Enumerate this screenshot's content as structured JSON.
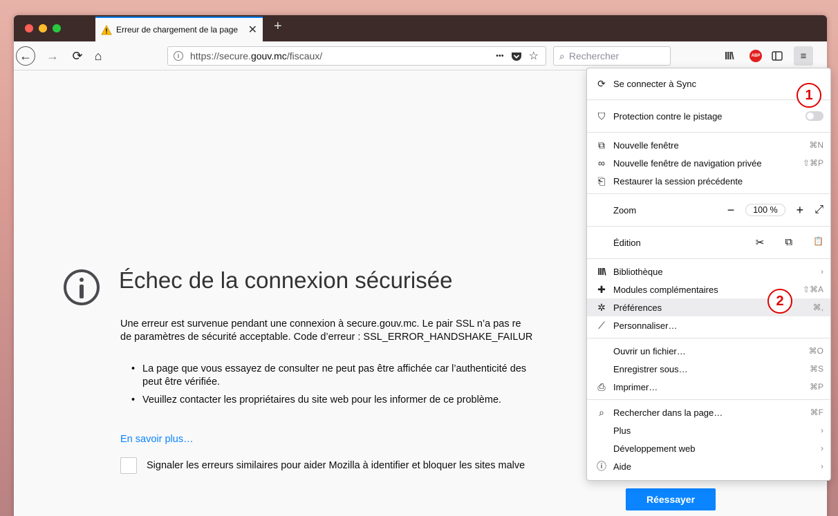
{
  "tab": {
    "title": "Erreur de chargement de la page",
    "close": "✕",
    "new_tab": "+"
  },
  "nav": {
    "back": "←",
    "forward": "→",
    "reload": "⟳",
    "home": "⌂",
    "url_prefix": "https://secure.",
    "url_domain": "gouv.mc",
    "url_path": "/fiscaux/",
    "page_actions": "•••",
    "search_placeholder": "Rechercher",
    "library": "lll\\",
    "abp": "ABP",
    "menu": "≡"
  },
  "error": {
    "title": "Échec de la connexion sécurisée",
    "desc_line1": "Une erreur est survenue pendant une connexion à secure.gouv.mc. Le pair SSL n’a pas re",
    "desc_line2": "de paramètres de sécurité acceptable. Code d’erreur : SSL_ERROR_HANDSHAKE_FAILUR",
    "bullet1_line1": "La page que vous essayez de consulter ne peut pas être affichée car l’authenticité des",
    "bullet1_line2": "peut être vérifiée.",
    "bullet2": "Veuillez contacter les propriétaires du site web pour les informer de ce problème.",
    "learn_more": "En savoir plus…",
    "report_label": "Signaler les erreurs similaires pour aider Mozilla à identifier et bloquer les sites malve",
    "retry": "Réessayer"
  },
  "menu": {
    "sync": "Se connecter à Sync",
    "tracking": "Protection contre le pistage",
    "new_window": {
      "label": "Nouvelle fenêtre",
      "shortcut": "⌘N"
    },
    "private_window": {
      "label": "Nouvelle fenêtre de navigation privée",
      "shortcut": "⇧⌘P"
    },
    "restore": "Restaurer la session précédente",
    "zoom": {
      "label": "Zoom",
      "minus": "−",
      "value": "100 %",
      "plus": "+",
      "fullscreen": "⤢"
    },
    "edit": {
      "label": "Édition",
      "cut": "✂",
      "copy": "⧉",
      "paste": "📋"
    },
    "library": {
      "label": "Bibliothèque",
      "arrow": "›"
    },
    "addons": {
      "label": "Modules complémentaires",
      "shortcut": "⇧⌘A"
    },
    "prefs": {
      "label": "Préférences",
      "shortcut": "⌘,"
    },
    "customize": "Personnaliser…",
    "open_file": {
      "label": "Ouvrir un fichier…",
      "shortcut": "⌘O"
    },
    "save_as": {
      "label": "Enregistrer sous…",
      "shortcut": "⌘S"
    },
    "print": {
      "label": "Imprimer…",
      "shortcut": "⌘P"
    },
    "find": {
      "label": "Rechercher dans la page…",
      "shortcut": "⌘F"
    },
    "more": {
      "label": "Plus",
      "arrow": "›"
    },
    "webdev": {
      "label": "Développement web",
      "arrow": "›"
    },
    "help": {
      "label": "Aide",
      "arrow": "›"
    }
  },
  "annotations": {
    "step1": "1",
    "step2": "2"
  },
  "colors": {
    "accent": "#0a84ff",
    "annotation": "#e00000"
  }
}
